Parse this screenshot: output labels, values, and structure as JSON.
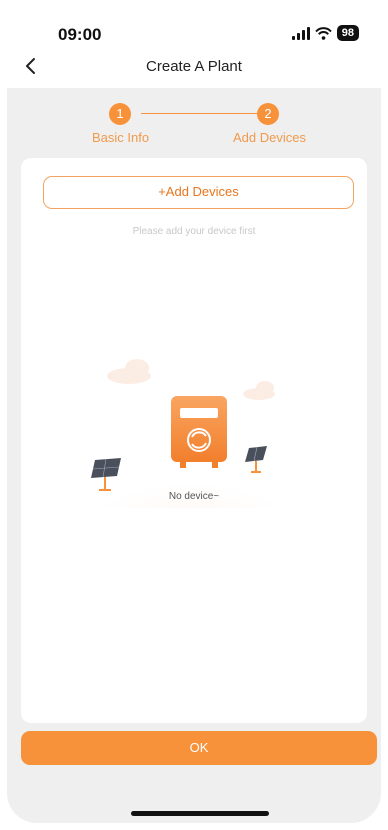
{
  "status_bar": {
    "time": "09:00",
    "battery": "98"
  },
  "header": {
    "title": "Create A Plant"
  },
  "stepper": {
    "steps": [
      {
        "number": "1",
        "label": "Basic Info"
      },
      {
        "number": "2",
        "label": "Add Devices"
      }
    ]
  },
  "content": {
    "add_button": "+Add Devices",
    "hint": "Please add your device first",
    "empty_text": "No device~"
  },
  "footer": {
    "ok_label": "OK"
  },
  "colors": {
    "accent": "#f7923b",
    "background": "#efefef",
    "card": "#ffffff"
  },
  "icons": [
    "back-chevron-icon",
    "signal-icon",
    "wifi-icon",
    "battery-icon",
    "inverter-icon",
    "solar-panel-icon",
    "cloud-icon"
  ]
}
